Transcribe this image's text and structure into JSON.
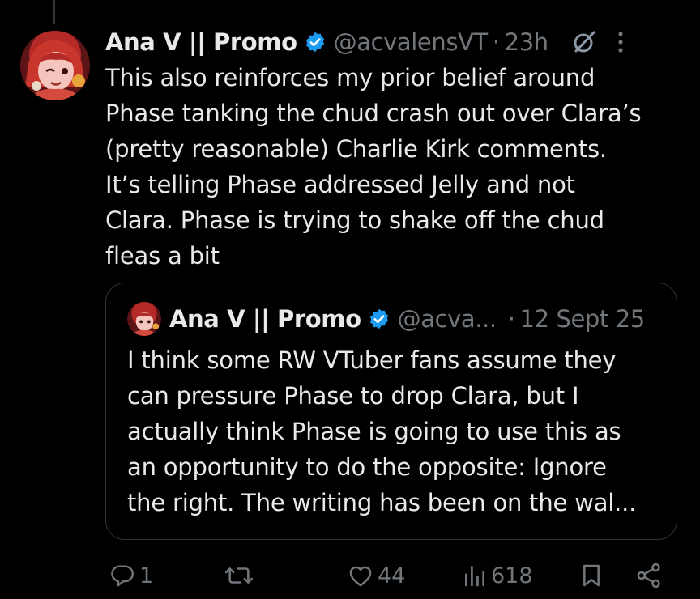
{
  "tweet": {
    "author_name": "Ana V || Promo",
    "handle": "@acvalensVT",
    "time": "23h",
    "separator": "·",
    "text": "This also reinforces my prior belief around\nPhase tanking the chud crash out over Clara’s\n(pretty reasonable) Charlie Kirk comments.\nIt’s telling Phase addressed Jelly and not\nClara. Phase is trying to shake off the chud\nfleas a bit",
    "icons": {
      "verified": "verified-badge-icon",
      "grok": "grok-icon",
      "more": "more-options-icon"
    }
  },
  "quote": {
    "author_name": "Ana V || Promo",
    "handle": "@acva...",
    "separator": "·",
    "date": "12 Sept 25",
    "text": "I think some RW VTuber fans assume they\ncan pressure Phase to drop Clara, but I\nactually think Phase is going to use this as\nan opportunity to do the opposite: Ignore\nthe right. The writing has been on the wal..."
  },
  "actions": {
    "reply_count": "1",
    "retweet_count": "",
    "like_count": "44",
    "view_count": "618",
    "icons": [
      "reply-icon",
      "retweet-icon",
      "like-icon",
      "views-icon",
      "bookmark-icon",
      "share-icon"
    ]
  },
  "colors": {
    "background": "#000000",
    "text": "#e7e9ea",
    "muted": "#71767b",
    "verified": "#1d9bf0",
    "border": "#2f3336"
  }
}
